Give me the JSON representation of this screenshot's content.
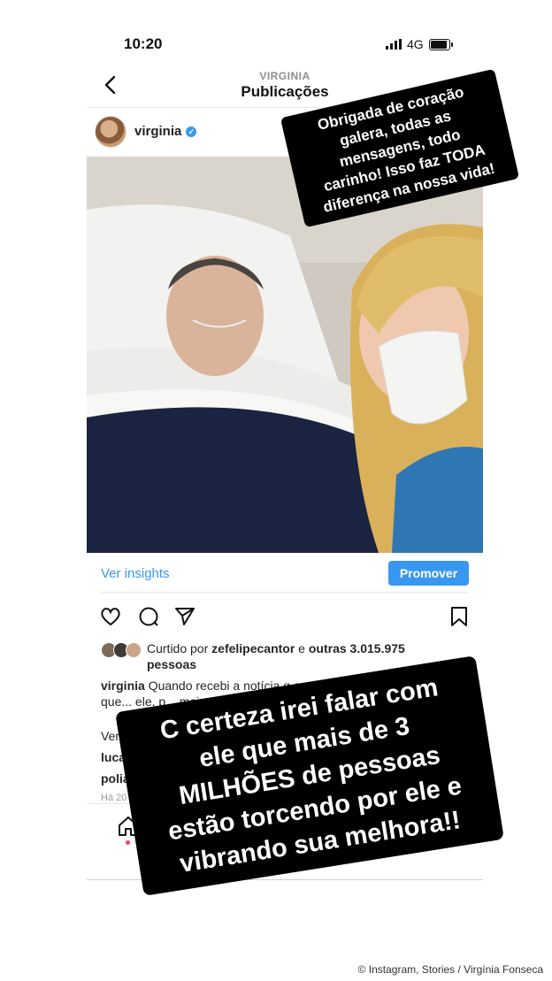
{
  "status_bar": {
    "time": "10:20",
    "network": "4G"
  },
  "header": {
    "account": "VIRGINIA",
    "title": "Publicações"
  },
  "post": {
    "username": "virginia",
    "insights_label": "Ver insights",
    "promote_label": "Promover",
    "likes_prefix": "Curtido por",
    "liked_by": "zefelipecantor",
    "likes_mid": " e ",
    "likes_others": "outras 3.015.975 pessoas",
    "caption_user": "virginia",
    "caption_text": "Quando recebi a notícia q conse... correndo do jeito que... ele, p... mais",
    "view_comments": "Ver to...",
    "comments": [
      {
        "user": "lucasrannge..."
      },
      {
        "user": "poliana",
        "text": "🙌🏻"
      }
    ],
    "time_ago": "Há 20 hor..."
  },
  "stickers": {
    "top": "Obrigada de coração\ngalera, todas as\nmensagens, todo\ncarinho! Isso faz TODA\ndiferença na nossa vida!",
    "bottom": "C certeza irei falar com\nele que mais de 3\nMILHÕES de pessoas\nestão torcendo por ele e\nvibrando sua melhora!!"
  },
  "credit": "© Instagram, Stories / Virgínia Fonseca",
  "colors": {
    "accent": "#3897f0",
    "notification": "#ed4956",
    "sticker_bg": "#000000"
  }
}
